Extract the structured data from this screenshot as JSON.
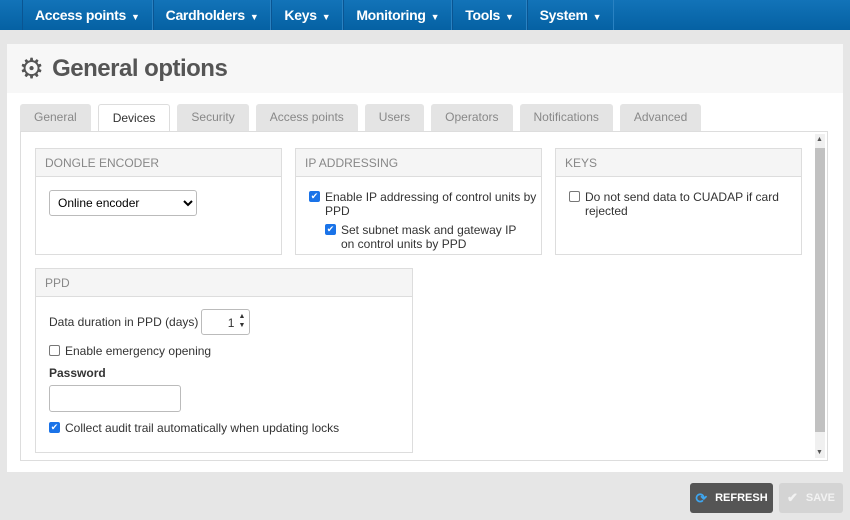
{
  "nav": [
    {
      "label": "Access points"
    },
    {
      "label": "Cardholders"
    },
    {
      "label": "Keys"
    },
    {
      "label": "Monitoring"
    },
    {
      "label": "Tools"
    },
    {
      "label": "System"
    }
  ],
  "page": {
    "title": "General options",
    "icon": "gear-icon"
  },
  "tabs": [
    {
      "label": "General"
    },
    {
      "label": "Devices",
      "active": true
    },
    {
      "label": "Security"
    },
    {
      "label": "Access points"
    },
    {
      "label": "Users"
    },
    {
      "label": "Operators"
    },
    {
      "label": "Notifications"
    },
    {
      "label": "Advanced"
    }
  ],
  "dongle": {
    "title": "DONGLE ENCODER",
    "selected": "Online encoder"
  },
  "ip": {
    "title": "IP ADDRESSING",
    "enable_label": "Enable IP addressing of control units by PPD",
    "enable_checked": true,
    "subnet_label": "Set subnet mask and gateway IP on control units by PPD",
    "subnet_checked": true
  },
  "keys": {
    "title": "KEYS",
    "no_send_label": "Do not send data to CUADAP if card rejected",
    "no_send_checked": false
  },
  "ppd": {
    "title": "PPD",
    "duration_label": "Data duration in PPD (days)",
    "duration_value": "1",
    "emergency_label": "Enable emergency opening",
    "emergency_checked": false,
    "password_label": "Password",
    "password_value": "",
    "audit_label": "Collect audit trail automatically when updating locks",
    "audit_checked": true
  },
  "buttons": {
    "refresh": "REFRESH",
    "save": "SAVE"
  },
  "colors": {
    "nav": "#0a67ad",
    "checkbox": "#1a73e8",
    "refresh_bg": "#555555",
    "save_bg": "#d4d4d4"
  }
}
